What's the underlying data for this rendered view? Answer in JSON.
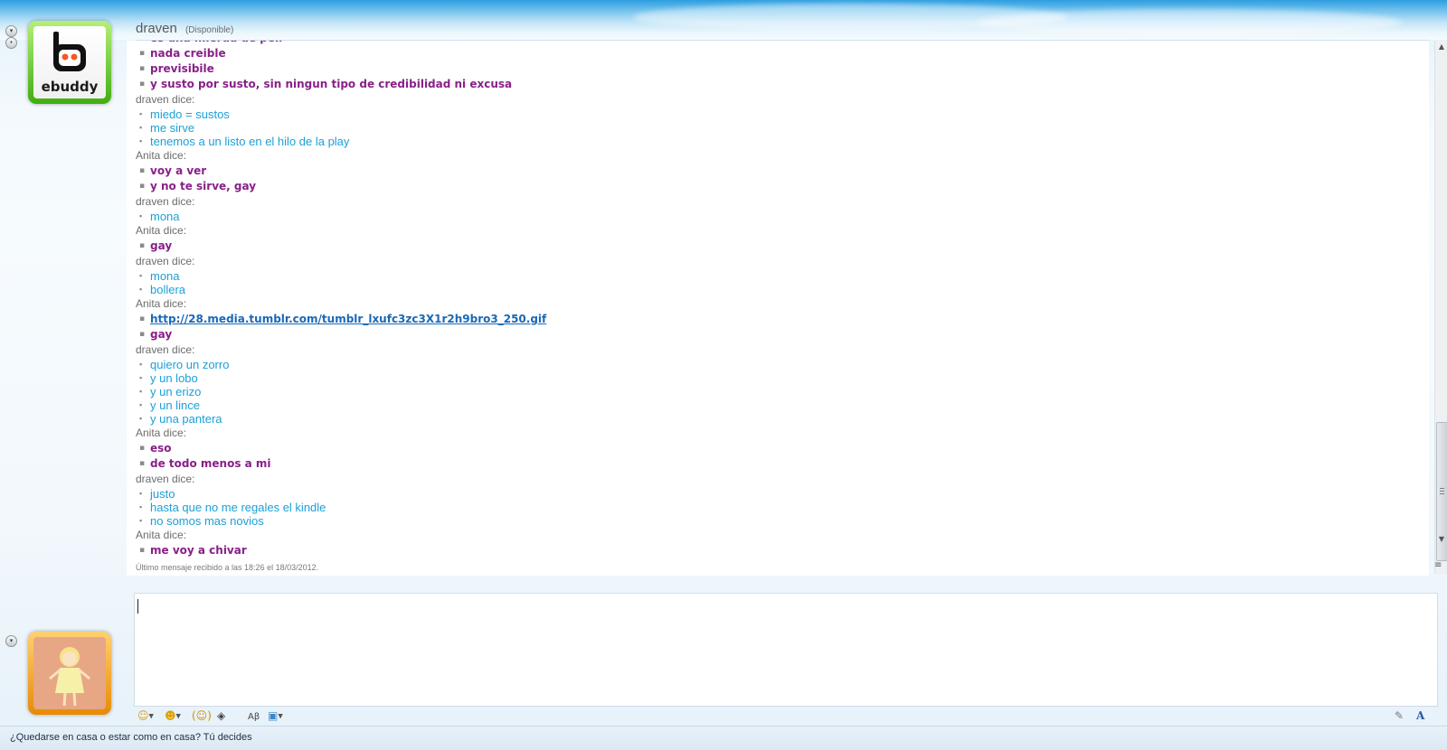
{
  "contact": {
    "name": "draven",
    "status": "(Disponible)"
  },
  "ebuddy_logo_text": "ebuddy",
  "messages": [
    {
      "type": "msg",
      "who": "a",
      "text": "es una mierda de peli"
    },
    {
      "type": "msg",
      "who": "a",
      "text": "nada creible"
    },
    {
      "type": "msg",
      "who": "a",
      "text": "previsibile"
    },
    {
      "type": "msg",
      "who": "a",
      "text": "y susto por susto, sin ningun tipo de credibilidad ni excusa"
    },
    {
      "type": "speaker",
      "text": "draven dice:"
    },
    {
      "type": "msg",
      "who": "d",
      "text": "miedo = sustos"
    },
    {
      "type": "msg",
      "who": "d",
      "text": "me sirve"
    },
    {
      "type": "msg",
      "who": "d",
      "text": "tenemos a un listo en el hilo de la play"
    },
    {
      "type": "speaker",
      "text": "Anita dice:"
    },
    {
      "type": "msg",
      "who": "a",
      "text": "voy a ver"
    },
    {
      "type": "msg",
      "who": "a",
      "text": "y no te sirve, gay"
    },
    {
      "type": "speaker",
      "text": "draven dice:"
    },
    {
      "type": "msg",
      "who": "d",
      "text": "mona"
    },
    {
      "type": "speaker",
      "text": "Anita dice:"
    },
    {
      "type": "msg",
      "who": "a",
      "text": "gay"
    },
    {
      "type": "speaker",
      "text": "draven dice:"
    },
    {
      "type": "msg",
      "who": "d",
      "text": "mona"
    },
    {
      "type": "msg",
      "who": "d",
      "text": "bollera"
    },
    {
      "type": "speaker",
      "text": "Anita dice:"
    },
    {
      "type": "msg",
      "who": "l",
      "text": "http://28.media.tumblr.com/tumblr_lxufc3zc3X1r2h9bro3_250.gif"
    },
    {
      "type": "msg",
      "who": "a",
      "text": "gay"
    },
    {
      "type": "speaker",
      "text": "draven dice:"
    },
    {
      "type": "msg",
      "who": "d",
      "text": "quiero un zorro"
    },
    {
      "type": "msg",
      "who": "d",
      "text": "y un lobo"
    },
    {
      "type": "msg",
      "who": "d",
      "text": "y un erizo"
    },
    {
      "type": "msg",
      "who": "d",
      "text": "y un lince"
    },
    {
      "type": "msg",
      "who": "d",
      "text": "y una pantera"
    },
    {
      "type": "speaker",
      "text": "Anita dice:"
    },
    {
      "type": "msg",
      "who": "a",
      "text": "eso"
    },
    {
      "type": "msg",
      "who": "a",
      "text": "de todo menos a mi"
    },
    {
      "type": "speaker",
      "text": "draven dice:"
    },
    {
      "type": "msg",
      "who": "d",
      "text": "justo"
    },
    {
      "type": "msg",
      "who": "d",
      "text": "hasta que no me regales el kindle"
    },
    {
      "type": "msg",
      "who": "d",
      "text": "no somos mas novios"
    },
    {
      "type": "speaker",
      "text": "Anita dice:"
    },
    {
      "type": "msg",
      "who": "a",
      "text": "me voy a chivar"
    }
  ],
  "last_message": "Último mensaje recibido a las 18:26 el 18/03/2012.",
  "input": {
    "value": ""
  },
  "toolbar_icons": [
    "emoticon-icon",
    "wink-icon",
    "nudge-icon",
    "voice-clip-icon",
    "spell-check-icon",
    "background-icon",
    "handwriting-icon",
    "font-icon"
  ],
  "ad": {
    "text": "¿Quedarse en casa o estar como en casa? Tú decides"
  },
  "colors": {
    "anita_text": "#892089",
    "draven_text": "#1ba0d8",
    "link": "#1a68b8",
    "speaker": "#6c6c6c"
  }
}
